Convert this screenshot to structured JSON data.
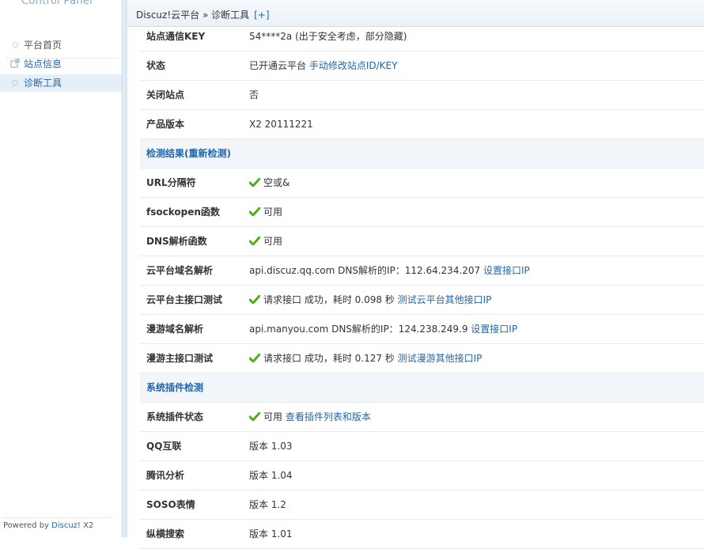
{
  "sidebar": {
    "logo": "Control Panel",
    "items": [
      {
        "label": "平台首页",
        "icon": "circle-bullet-icon"
      },
      {
        "label": "站点信息",
        "icon": "external-link-icon"
      },
      {
        "label": "诊断工具",
        "icon": "circle-bullet-icon"
      }
    ],
    "footer_prefix": "Powered by ",
    "footer_brand": "Discuz!",
    "footer_suffix": " X2"
  },
  "breadcrumb": {
    "text": "Discuz!云平台 » 诊断工具",
    "expand": "[+]"
  },
  "rows_top": [
    {
      "key": "站点通信KEY",
      "value": "54****2a (出于安全考虑，部分隐藏)"
    },
    {
      "key": "状态",
      "value": "已开通云平台 ",
      "link": "手动修改站点ID/KEY"
    },
    {
      "key": "关闭站点",
      "value": "否"
    },
    {
      "key": "产品版本",
      "value": "X2 20111221"
    }
  ],
  "section1": {
    "title": "检测结果(重新检测)"
  },
  "rows_check": [
    {
      "key": "URL分隔符",
      "check": true,
      "value": "空或&"
    },
    {
      "key": "fsockopen函数",
      "check": true,
      "value": "可用"
    },
    {
      "key": "DNS解析函数",
      "check": true,
      "value": "可用"
    },
    {
      "key": "云平台域名解析",
      "check": false,
      "value": "api.discuz.qq.com DNS解析的IP：112.64.234.207 ",
      "link": "设置接口IP"
    },
    {
      "key": "云平台主接口测试",
      "check": true,
      "value": "请求接口 成功，耗时 0.098 秒 ",
      "link": "测试云平台其他接口IP"
    },
    {
      "key": "漫游域名解析",
      "check": false,
      "value": "api.manyou.com DNS解析的IP：124.238.249.9 ",
      "link": "设置接口IP"
    },
    {
      "key": "漫游主接口测试",
      "check": true,
      "value": "请求接口 成功，耗时 0.127 秒 ",
      "link": "测试漫游其他接口IP"
    }
  ],
  "section2": {
    "title": "系统插件检测"
  },
  "rows_plugins": [
    {
      "key": "系统插件状态",
      "check": true,
      "value": "可用 ",
      "link": "查看插件列表和版本"
    },
    {
      "key": "QQ互联",
      "check": false,
      "value": "版本 1.03"
    },
    {
      "key": "腾讯分析",
      "check": false,
      "value": "版本 1.04"
    },
    {
      "key": "SOSO表情",
      "check": false,
      "value": "版本 1.2"
    },
    {
      "key": "纵横搜索",
      "check": false,
      "value": "版本 1.01"
    }
  ],
  "colors": {
    "link": "#2366a8",
    "check": "#4caf1f",
    "section_bg": "#f2f6fa"
  }
}
